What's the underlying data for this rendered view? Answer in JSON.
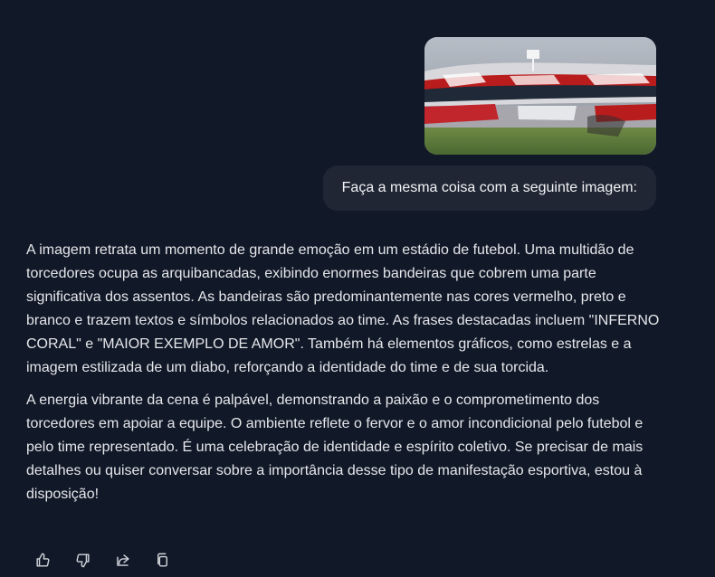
{
  "conversation": {
    "user_image": {
      "description_icon": "stadium-photo"
    },
    "user_message": "Faça a mesma coisa com a seguinte imagem:",
    "assistant_paragraphs": [
      "A imagem retrata um momento de grande emoção em um estádio de futebol. Uma multidão de torcedores ocupa as arquibancadas, exibindo enormes bandeiras que cobrem uma parte significativa dos assentos. As bandeiras são predominantemente nas cores vermelho, preto e branco e trazem textos e símbolos relacionados ao time. As frases destacadas incluem \"INFERNO CORAL\" e \"MAIOR EXEMPLO DE AMOR\". Também há elementos gráficos, como estrelas e a imagem estilizada de um diabo, reforçando a identidade do time e de sua torcida.",
      "A energia vibrante da cena é palpável, demonstrando a paixão e o comprometimento dos torcedores em apoiar a equipe. O ambiente reflete o fervor e o amor incondicional pelo futebol e pelo time representado. É uma celebração de identidade e espírito coletivo. Se precisar de mais detalhes ou quiser conversar sobre a importância desse tipo de manifestação esportiva, estou à disposição!"
    ],
    "actions": [
      {
        "name": "thumbs-up-icon"
      },
      {
        "name": "thumbs-down-icon"
      },
      {
        "name": "share-icon"
      },
      {
        "name": "copy-icon"
      }
    ]
  },
  "colors": {
    "background": "#111827",
    "bubble": "#202634",
    "text": "#e5e7eb",
    "accent_red": "#b91c1c"
  }
}
